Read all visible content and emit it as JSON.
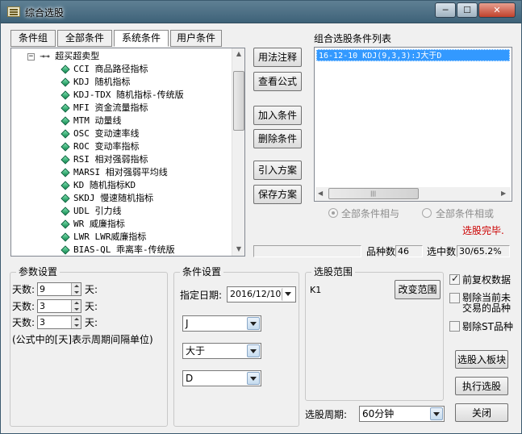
{
  "window": {
    "title": "综合选股",
    "controls": [
      "─",
      "☐",
      "✕"
    ]
  },
  "tabs": [
    "条件组",
    "全部条件",
    "系统条件",
    "用户条件"
  ],
  "tree": {
    "root": "超买超卖型",
    "items": [
      "CCI 商品路径指标",
      "KDJ 随机指标",
      "KDJ-TDX 随机指标-传统版",
      "MFI 资金流量指标",
      "MTM 动量线",
      "OSC 变动速率线",
      "ROC 变动率指标",
      "RSI 相对强弱指标",
      "MARSI 相对强弱平均线",
      "KD 随机指标KD",
      "SKDJ 慢速随机指标",
      "UDL 引力线",
      "WR 威廉指标",
      "LWR LWR威廉指标",
      "BIAS-QL 乖离率-传统版"
    ]
  },
  "middle_buttons": [
    "用法注释",
    "查看公式",
    "加入条件",
    "删除条件",
    "引入方案",
    "保存方案"
  ],
  "list": {
    "title": "组合选股条件列表",
    "items": [
      "16-12-10 KDJ(9,3,3):J大于D"
    ]
  },
  "radios": {
    "all_and": "全部条件相与",
    "all_or": "全部条件相或"
  },
  "status": {
    "done": "选股完毕.",
    "count_label": "品种数",
    "count_value": "46",
    "selected_label": "选中数",
    "selected_value": "30/65.2%"
  },
  "params": {
    "title": "参数设置",
    "rows": [
      {
        "label": "天数:",
        "value": "9",
        "unit": "天:"
      },
      {
        "label": "天数:",
        "value": "3",
        "unit": "天:"
      },
      {
        "label": "天数:",
        "value": "3",
        "unit": "天:"
      }
    ],
    "note": "(公式中的[天]表示周期间隔单位)"
  },
  "conditions": {
    "title": "条件设置",
    "date_label": "指定日期:",
    "date_value": "2016/12/10",
    "line": "J",
    "operator": "大于",
    "target": "D"
  },
  "range": {
    "title": "选股范围",
    "value": "K1",
    "change_button": "改变范围",
    "period_label": "选股周期:",
    "period_value": "60分钟"
  },
  "options": [
    {
      "label": "前复权数据",
      "checked": true
    },
    {
      "label": "剔除当前未交易的品种",
      "checked": false
    },
    {
      "label": "剔除ST品种",
      "checked": false
    }
  ],
  "actions": {
    "to_block": "选股入板块",
    "run": "执行选股",
    "close": "关闭"
  },
  "colors": {
    "selection": "#3399ff",
    "status_done": "#cc0000",
    "title_bar": "#4a6d82"
  }
}
